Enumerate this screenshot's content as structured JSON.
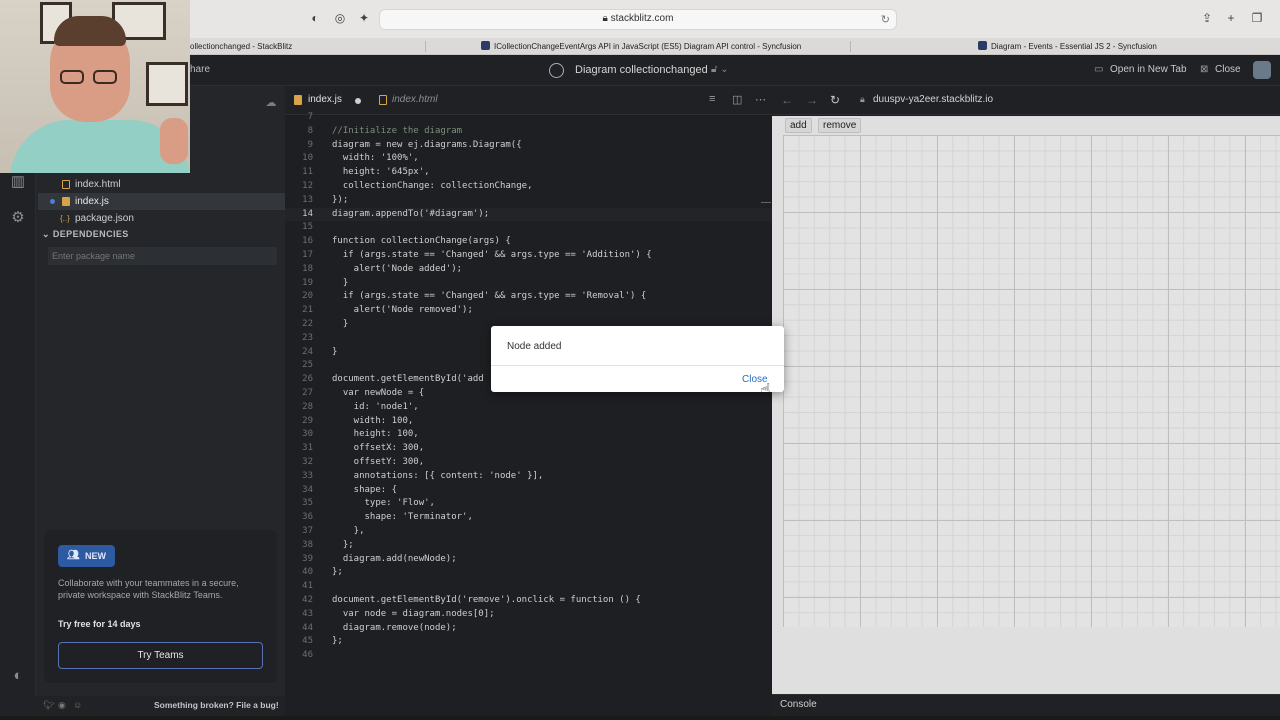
{
  "browser": {
    "url": "stackblitz.com",
    "tabs": [
      {
        "label": "ollectionchanged - StackBlitz"
      },
      {
        "label": "ICollectionChangeEventArgs API in JavaScript (ES5) Diagram API control - Syncfusion"
      },
      {
        "label": "Diagram - Events - Essential JS 2 - Syncfusion"
      }
    ]
  },
  "header": {
    "share_label": "hare",
    "project_title": "Diagram collectionchanged",
    "open_new_tab": "Open in New Tab",
    "close": "Close"
  },
  "sidebar": {
    "files": [
      {
        "label": "index.html"
      },
      {
        "label": "index.js"
      },
      {
        "label": "package.json"
      }
    ],
    "dependencies_label": "DEPENDENCIES",
    "package_placeholder": "Enter package name",
    "teams": {
      "badge": "NEW",
      "text": "Collaborate with your teammates in a secure, private workspace with StackBlitz Teams.",
      "free": "Try free for 14 days",
      "button": "Try Teams"
    },
    "broken_link": "Something broken? File a bug!"
  },
  "editor": {
    "tabs": [
      {
        "label": "index.js"
      },
      {
        "label": "index.html"
      }
    ],
    "lines": [
      {
        "n": "7",
        "t": ""
      },
      {
        "n": "8",
        "t": "//Initialize the diagram"
      },
      {
        "n": "9",
        "t": "diagram = new ej.diagrams.Diagram({"
      },
      {
        "n": "10",
        "t": "  width: '100%',"
      },
      {
        "n": "11",
        "t": "  height: '645px',"
      },
      {
        "n": "12",
        "t": "  collectionChange: collectionChange,"
      },
      {
        "n": "13",
        "t": "});"
      },
      {
        "n": "14",
        "t": "diagram.appendTo('#diagram');"
      },
      {
        "n": "15",
        "t": ""
      },
      {
        "n": "16",
        "t": "function collectionChange(args) {"
      },
      {
        "n": "17",
        "t": "  if (args.state == 'Changed' && args.type == 'Addition') {"
      },
      {
        "n": "18",
        "t": "    alert('Node added');"
      },
      {
        "n": "19",
        "t": "  }"
      },
      {
        "n": "20",
        "t": "  if (args.state == 'Changed' && args.type == 'Removal') {"
      },
      {
        "n": "21",
        "t": "    alert('Node removed');"
      },
      {
        "n": "22",
        "t": "  }"
      },
      {
        "n": "23",
        "t": ""
      },
      {
        "n": "24",
        "t": "}"
      },
      {
        "n": "25",
        "t": ""
      },
      {
        "n": "26",
        "t": "document.getElementById('add"
      },
      {
        "n": "27",
        "t": "  var newNode = {"
      },
      {
        "n": "28",
        "t": "    id: 'node1',"
      },
      {
        "n": "29",
        "t": "    width: 100,"
      },
      {
        "n": "30",
        "t": "    height: 100,"
      },
      {
        "n": "31",
        "t": "    offsetX: 300,"
      },
      {
        "n": "32",
        "t": "    offsetY: 300,"
      },
      {
        "n": "33",
        "t": "    annotations: [{ content: 'node' }],"
      },
      {
        "n": "34",
        "t": "    shape: {"
      },
      {
        "n": "35",
        "t": "      type: 'Flow',"
      },
      {
        "n": "36",
        "t": "      shape: 'Terminator',"
      },
      {
        "n": "37",
        "t": "    },"
      },
      {
        "n": "38",
        "t": "  };"
      },
      {
        "n": "39",
        "t": "  diagram.add(newNode);"
      },
      {
        "n": "40",
        "t": "};"
      },
      {
        "n": "41",
        "t": ""
      },
      {
        "n": "42",
        "t": "document.getElementById('remove').onclick = function () {"
      },
      {
        "n": "43",
        "t": "  var node = diagram.nodes[0];"
      },
      {
        "n": "44",
        "t": "  diagram.remove(node);"
      },
      {
        "n": "45",
        "t": "};"
      },
      {
        "n": "46",
        "t": ""
      }
    ]
  },
  "preview": {
    "url": "duuspv-ya2eer.stackblitz.io",
    "add_button": "add",
    "remove_button": "remove",
    "console_label": "Console"
  },
  "dialog": {
    "message": "Node added",
    "close_label": "Close"
  }
}
